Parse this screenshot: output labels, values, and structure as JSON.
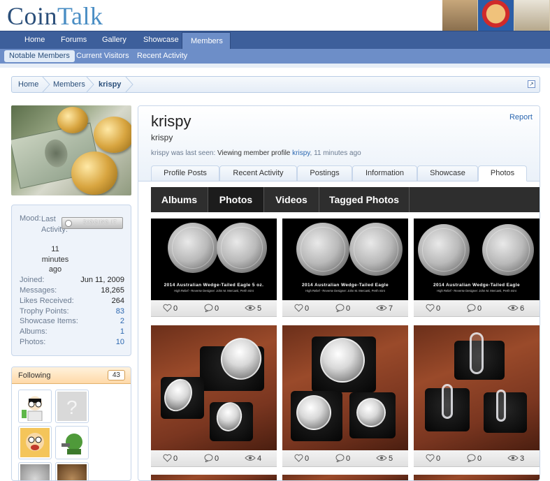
{
  "brand": {
    "logo_part1": "Coin",
    "logo_part2": "Talk"
  },
  "nav": {
    "tabs": [
      "Home",
      "Forums",
      "Gallery",
      "Showcase",
      "Members"
    ],
    "active": "Members"
  },
  "subnav": {
    "items": [
      "Notable Members",
      "Current Visitors",
      "Recent Activity"
    ],
    "active": "Notable Members"
  },
  "breadcrumb": [
    "Home",
    "Members",
    "krispy"
  ],
  "sidebar": {
    "mood_label": "Mood:",
    "mood_badge": "DIGGING IT",
    "last_activity_label": "Last Activity:",
    "last_activity_value": "11 minutes ago",
    "stats": [
      {
        "label": "Joined:",
        "value": "Jun 11, 2009",
        "link": false
      },
      {
        "label": "Messages:",
        "value": "18,265",
        "link": false
      },
      {
        "label": "Likes Received:",
        "value": "264",
        "link": false
      },
      {
        "label": "Trophy Points:",
        "value": "83",
        "link": true
      },
      {
        "label": "Showcase Items:",
        "value": "2",
        "link": true
      },
      {
        "label": "Albums:",
        "value": "1",
        "link": true
      },
      {
        "label": "Photos:",
        "value": "10",
        "link": true
      }
    ],
    "following": {
      "title": "Following",
      "count": "43"
    }
  },
  "profile": {
    "username": "krispy",
    "user_title": "krispy",
    "report": "Report",
    "last_seen_prefix": "krispy was last seen:",
    "last_seen_activity": "Viewing member profile",
    "last_seen_link": "krispy",
    "last_seen_time": ", 11 minutes ago",
    "tabs": [
      "Profile Posts",
      "Recent Activity",
      "Postings",
      "Information",
      "Showcase",
      "Photos"
    ],
    "active_tab": "Photos"
  },
  "media": {
    "tabs": [
      "Albums",
      "Photos",
      "Videos",
      "Tagged Photos"
    ],
    "active": "Photos",
    "photos": [
      {
        "likes": "0",
        "comments": "0",
        "views": "5",
        "kind": "coin",
        "caption": "2014 Australian Wedge-Tailed Eagle 5 oz.",
        "subcaption": "High Relief - Reverse Designer: John M. Mercanti, Perth mint"
      },
      {
        "likes": "0",
        "comments": "0",
        "views": "7",
        "kind": "coin",
        "caption": "2014 Australian Wedge-Tailed Eagle",
        "subcaption": "High Relief - Reverse Designer: John M. Mercanti, Perth mint"
      },
      {
        "likes": "0",
        "comments": "0",
        "views": "6",
        "kind": "coin",
        "caption": "2014 Australian Wedge-Tailed Eagle",
        "subcaption": "High Relief - Reverse Designer: John M. Mercanti, Perth mint"
      },
      {
        "likes": "0",
        "comments": "0",
        "views": "4",
        "kind": "wood1"
      },
      {
        "likes": "0",
        "comments": "0",
        "views": "5",
        "kind": "wood2"
      },
      {
        "likes": "0",
        "comments": "0",
        "views": "3",
        "kind": "wood3"
      }
    ]
  },
  "colors": {
    "nav": "#3d5f9b",
    "subnav": "#6d8ec8",
    "link": "#2b67b0",
    "following_head": "#ffd9a8"
  }
}
